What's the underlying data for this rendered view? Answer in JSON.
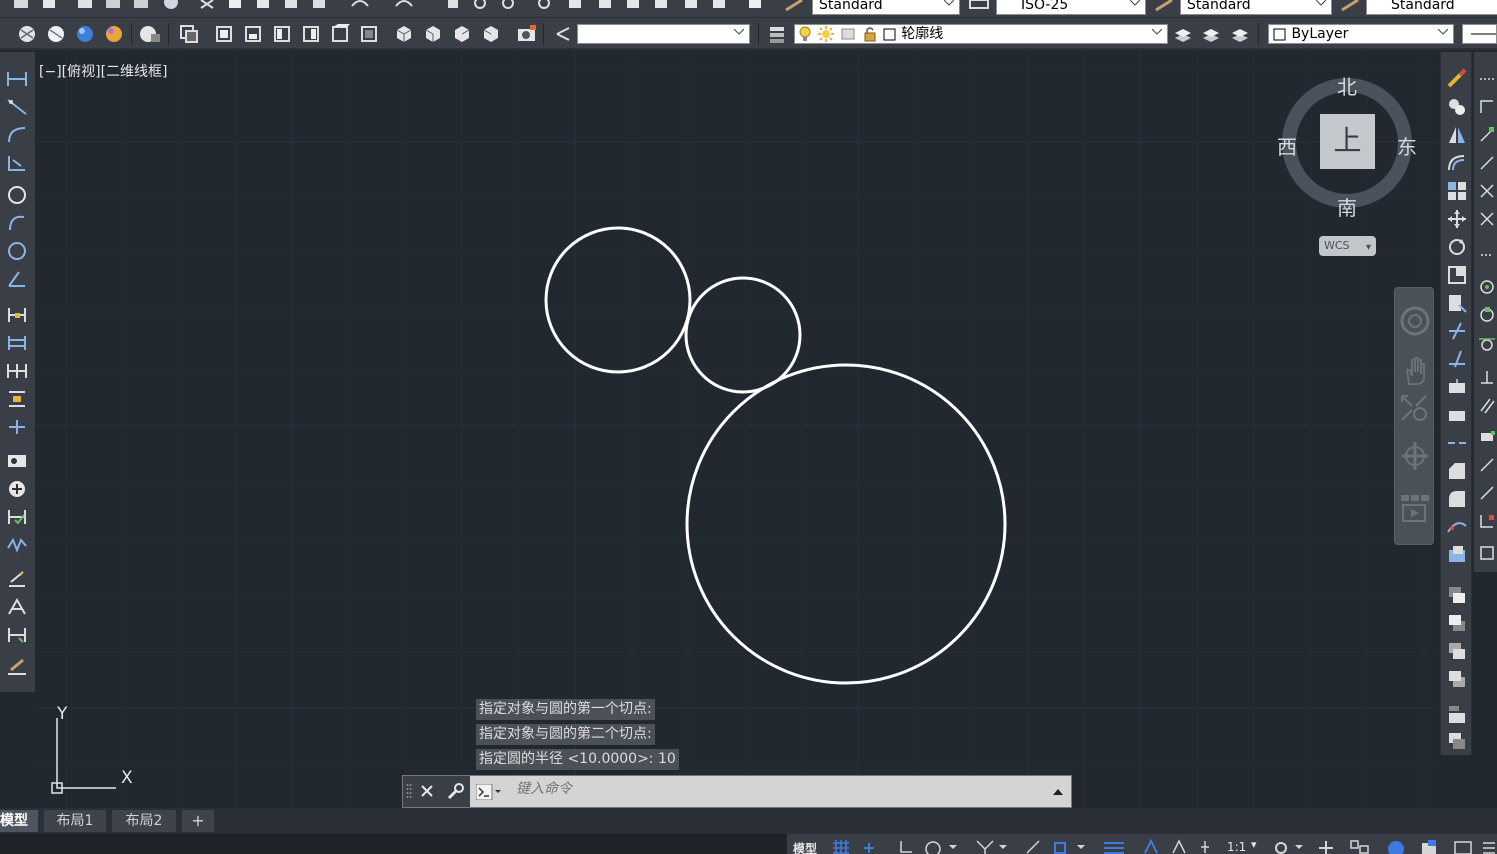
{
  "toolbar": {
    "text_style": "Standard",
    "dim_style": "ISO-25",
    "table_style": "Standard",
    "multileader_style": "Standard",
    "layer": "轮廓线",
    "color": "ByLayer",
    "workspace_combo": ""
  },
  "viewport": {
    "label": "[−][俯视][二维线框]"
  },
  "viewcube": {
    "north": "北",
    "south": "南",
    "east": "东",
    "west": "西",
    "face": "上",
    "ucs": "WCS"
  },
  "ucs_icon": {
    "x": "X",
    "y": "Y"
  },
  "command": {
    "history": [
      "指定对象与圆的第一个切点:",
      "指定对象与圆的第二个切点:",
      "指定圆的半径 <10.0000>: 10"
    ],
    "placeholder": "键入命令"
  },
  "tabs": [
    "模型",
    "布局1",
    "布局2",
    "+"
  ],
  "status": {
    "model": "模型",
    "scale": "1:1"
  },
  "colors": {
    "canvas": "#212830",
    "toolbar": "#3a3f47",
    "accent": "#3d7be0"
  }
}
